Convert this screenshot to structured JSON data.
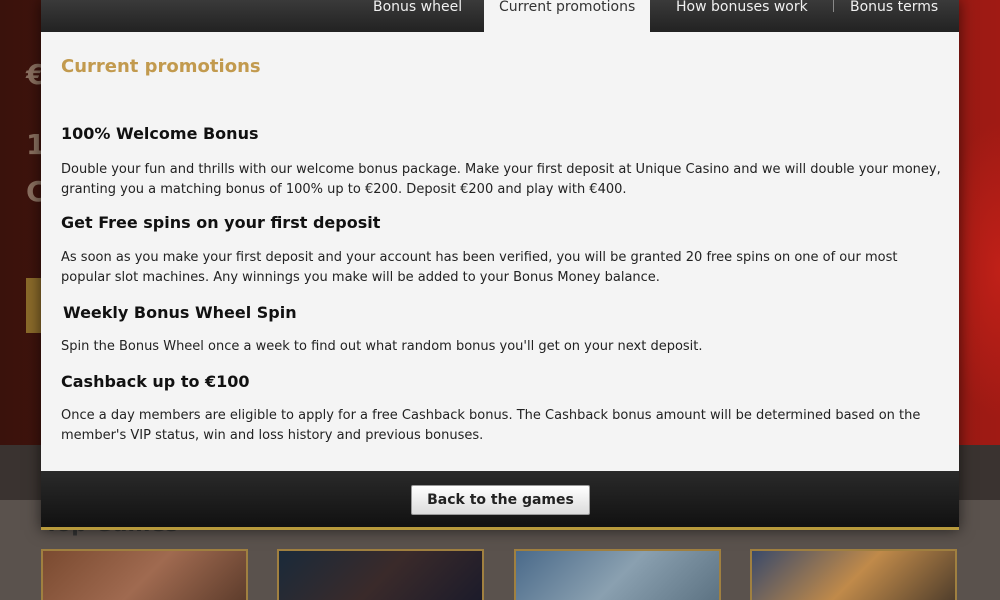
{
  "tabs": [
    {
      "label": "Bonus wheel",
      "active": false
    },
    {
      "label": "Current promotions",
      "active": true
    },
    {
      "label": "How bonuses work",
      "active": false
    },
    {
      "label": "Bonus terms",
      "active": false
    }
  ],
  "section_title": "Current promotions",
  "promotions": [
    {
      "title": "100% Welcome Bonus",
      "text": "Double your fun and thrills with our welcome bonus package. Make your first deposit at Unique Casino and we will double your money, granting you a matching bonus of 100% up to €200. Deposit €200 and play with €400."
    },
    {
      "title": "Get Free spins on your first deposit",
      "text": "As soon as you make your first deposit and your account has been verified, you will be granted 20 free spins on one of our most popular slot machines. Any winnings you make will be added to your Bonus Money balance."
    },
    {
      "title": "Weekly Bonus Wheel Spin",
      "text": "Spin the Bonus Wheel once a week to find out what random bonus you'll get on your next deposit."
    },
    {
      "title": "Cashback up to €100",
      "text": "Once a day members are eligible to apply for a free Cashback bonus. The Cashback bonus amount will be determined based on the member's VIP status, win and loss history and previous bonuses."
    }
  ],
  "footer": {
    "back_label": "Back to the games"
  },
  "background": {
    "hero_line1": "€",
    "hero_line2": "1",
    "hero_line3": "C",
    "games_title": "Top Games"
  },
  "colors": {
    "accent_gold": "#c29a4e",
    "footer_border": "#b89a3c"
  }
}
